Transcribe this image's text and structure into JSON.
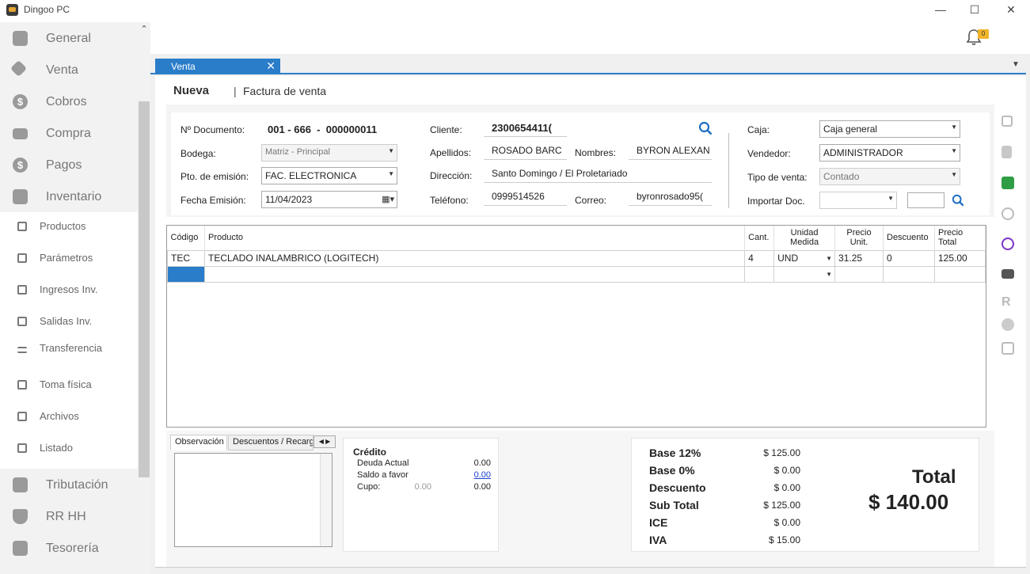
{
  "window": {
    "title": "Dingoo PC",
    "minimize": "—",
    "maximize": "☐",
    "close": "✕"
  },
  "sidebar": {
    "main_items": [
      {
        "label": "General"
      },
      {
        "label": "Venta"
      },
      {
        "label": "Cobros"
      },
      {
        "label": "Compra"
      },
      {
        "label": "Pagos"
      },
      {
        "label": "Inventario"
      }
    ],
    "sub_items": [
      {
        "label": "Productos"
      },
      {
        "label": "Parámetros"
      },
      {
        "label": "Ingresos Inv."
      },
      {
        "label": "Salidas Inv."
      },
      {
        "label": "Transferencia"
      },
      {
        "label": "Toma física"
      },
      {
        "label": "Archivos"
      },
      {
        "label": "Listado"
      }
    ],
    "bottom_items": [
      {
        "label": "Tributación"
      },
      {
        "label": "RR HH"
      },
      {
        "label": "Tesorería"
      }
    ]
  },
  "notifications": {
    "count": "0"
  },
  "tab": {
    "label": "Venta",
    "close": "✕"
  },
  "header": {
    "mode": "Nueva",
    "separator": "|",
    "title": "Factura de venta"
  },
  "form": {
    "doc_label": "Nº Documento:",
    "doc_value": "001 - 666  -  000000011",
    "bodega_label": "Bodega:",
    "bodega_value": "Matriz - Principal",
    "pto_label": "Pto. de emisión:",
    "pto_value": "FAC. ELECTRONICA",
    "fecha_label": "Fecha Emisión:",
    "fecha_value": "11/04/2023",
    "cliente_label": "Cliente:",
    "cliente_value": "2300654411(",
    "apellidos_label": "Apellidos:",
    "apellidos_value": "ROSADO BARC",
    "nombres_label": "Nombres:",
    "nombres_value": "BYRON ALEXAN",
    "direccion_label": "Dirección:",
    "direccion_value": "Santo Domingo / El Proletariado",
    "telefono_label": "Teléfono:",
    "telefono_value": "0999514526",
    "correo_label": "Correo:",
    "correo_value": "byronrosado95(",
    "caja_label": "Caja:",
    "caja_value": "Caja general",
    "vendedor_label": "Vendedor:",
    "vendedor_value": "ADMINISTRADOR",
    "tipo_label": "Tipo de venta:",
    "tipo_value": "Contado",
    "importar_label": "Importar Doc.",
    "importar_value": ""
  },
  "grid": {
    "headers": {
      "codigo": "Código",
      "producto": "Producto",
      "cant": "Cant.",
      "unidad": "Unidad Medida",
      "precio": "Precio Unit.",
      "descuento": "Descuento",
      "total": "Precio Total"
    },
    "rows": [
      {
        "codigo": "TEC",
        "producto": "TECLADO INALAMBRICO (LOGITECH)",
        "cant": "4",
        "unidad": "UND",
        "precio": "31.25",
        "descuento": "0",
        "total": "125.00"
      }
    ]
  },
  "bottom_tabs": {
    "obs": "Observación",
    "desc": "Descuentos / Recargos"
  },
  "credit": {
    "title": "Crédito",
    "deuda_label": "Deuda Actual",
    "deuda_value": "0.00",
    "saldo_label": "Saldo a favor",
    "saldo_value": "0.00",
    "cupo_label": "Cupo:",
    "cupo_value1": "0.00",
    "cupo_value2": "0.00"
  },
  "totals": {
    "base12_label": "Base 12%",
    "base12_value": "$ 125.00",
    "base0_label": "Base 0%",
    "base0_value": "$ 0.00",
    "desc_label": "Descuento",
    "desc_value": "$ 0.00",
    "subtotal_label": "Sub Total",
    "subtotal_value": "$ 125.00",
    "ice_label": "ICE",
    "ice_value": "$ 0.00",
    "iva_label": "IVA",
    "iva_value": "$ 15.00",
    "total_label": "Total",
    "total_value": "$ 140.00"
  },
  "colors": {
    "accent": "#2a7dc9",
    "save": "#2e9e44",
    "search": "#1e6fc2"
  }
}
